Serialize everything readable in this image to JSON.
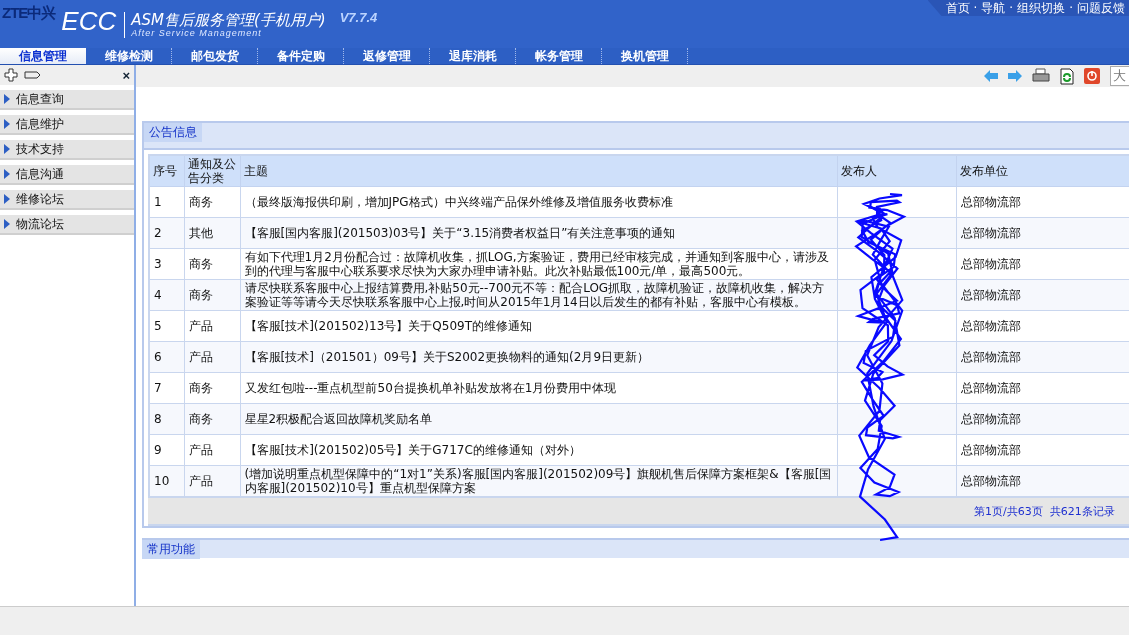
{
  "header": {
    "brand": "ZTE中兴",
    "product": "ECC",
    "title": "ASM售后服务管理(手机用户)",
    "subtitle": "After Service Management",
    "version": "V7.7.4",
    "links": [
      "首页",
      "导航",
      "组织切换",
      "问题反馈"
    ],
    "link_separator": "·"
  },
  "tabs": [
    {
      "label": "信息管理",
      "selected": true
    },
    {
      "label": "维修检测",
      "selected": false
    },
    {
      "label": "邮包发货",
      "selected": false
    },
    {
      "label": "备件定购",
      "selected": false
    },
    {
      "label": "返修管理",
      "selected": false
    },
    {
      "label": "退库消耗",
      "selected": false
    },
    {
      "label": "帐务管理",
      "selected": false
    },
    {
      "label": "换机管理",
      "selected": false
    }
  ],
  "sidebar": {
    "close": "×",
    "items": [
      "信息查询",
      "信息维护",
      "技术支持",
      "信息沟通",
      "维修论坛",
      "物流论坛"
    ]
  },
  "toolbar": {
    "field_value": "大"
  },
  "notice": {
    "title": "公告信息",
    "columns": [
      "序号",
      "通知及公告分类",
      "主题",
      "发布人",
      "发布单位"
    ],
    "rows": [
      {
        "no": "1",
        "category": "商务",
        "subject": "（最终版海报供印刷，增加JPG格式）中兴终端产品保外维修及增值服务收费标准",
        "unit": "总部物流部"
      },
      {
        "no": "2",
        "category": "其他",
        "subject": "【客服[国内客服](201503)03号】关于“3.15消费者权益日”有关注意事项的通知",
        "unit": "总部物流部"
      },
      {
        "no": "3",
        "category": "商务",
        "subject": "有如下代理1月2月份配合过：故障机收集，抓LOG,方案验证，费用已经审核完成，并通知到客服中心，请涉及到的代理与客服中心联系要求尽快为大家办理申请补贴。此次补贴最低100元/单，最高500元。",
        "unit": "总部物流部"
      },
      {
        "no": "4",
        "category": "商务",
        "subject": "请尽快联系客服中心上报结算费用,补贴50元--700元不等：配合LOG抓取，故障机验证，故障机收集，解决方案验证等等请今天尽快联系客服中心上报,时间从2015年1月14日以后发生的都有补贴，客服中心有模板。",
        "unit": "总部物流部"
      },
      {
        "no": "5",
        "category": "产品",
        "subject": "【客服[技术](201502)13号】关于Q509T的维修通知",
        "unit": "总部物流部"
      },
      {
        "no": "6",
        "category": "产品",
        "subject": "【客服[技术]（201501）09号】关于S2002更换物料的通知(2月9日更新）",
        "unit": "总部物流部"
      },
      {
        "no": "7",
        "category": "商务",
        "subject": "又发红包啦---重点机型前50台提换机单补贴发放将在1月份费用中体现",
        "unit": "总部物流部"
      },
      {
        "no": "8",
        "category": "商务",
        "subject": "星星2积极配合返回故障机奖励名单",
        "unit": "总部物流部"
      },
      {
        "no": "9",
        "category": "产品",
        "subject": "【客服[技术](201502)05号】关于G717C的维修通知（对外）",
        "unit": "总部物流部"
      },
      {
        "no": "10",
        "category": "产品",
        "subject": "(增加说明重点机型保障中的“1对1”关系)客服[国内客服](201502)09号】旗舰机售后保障方案框架&【客服[国内客服](201502)10号】重点机型保障方案",
        "unit": "总部物流部"
      }
    ],
    "pager": "第1页/共63页  共621条记录"
  },
  "common": {
    "title": "常用功能"
  }
}
